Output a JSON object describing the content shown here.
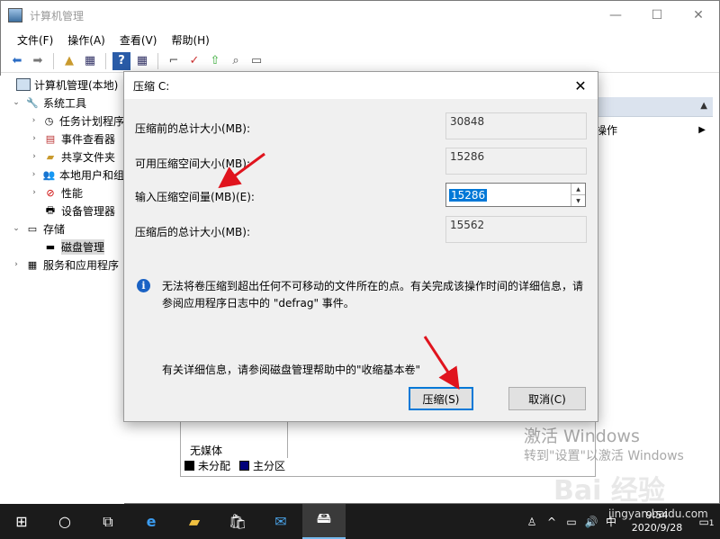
{
  "main": {
    "title": "计算机管理",
    "controls": {
      "minimize": "—",
      "maximize": "☐",
      "close": "✕"
    },
    "menu": [
      "文件(F)",
      "操作(A)",
      "查看(V)",
      "帮助(H)"
    ]
  },
  "tree": {
    "root": "计算机管理(本地)",
    "system_tools": "系统工具",
    "task_scheduler": "任务计划程序",
    "event_viewer": "事件查看器",
    "shared_folders": "共享文件夹",
    "local_users": "本地用户和组",
    "performance": "性能",
    "device_manager": "设备管理器",
    "storage": "存储",
    "disk_management": "磁盘管理",
    "services_apps": "服务和应用程序"
  },
  "actions": {
    "row_label": "操作"
  },
  "lower": {
    "no_media": "无媒体",
    "legend_unallocated": "未分配",
    "legend_primary": "主分区"
  },
  "watermark": {
    "line1": "激活 Windows",
    "line2": "转到\"设置\"以激活 Windows",
    "baidu": "Bai  经验",
    "site": "jingyan.baidu.com"
  },
  "dialog": {
    "title": "压缩 C:",
    "close": "✕",
    "total_before_label": "压缩前的总计大小(MB):",
    "total_before_value": "30848",
    "available_label": "可用压缩空间大小(MB):",
    "available_value": "15286",
    "input_label": "输入压缩空间量(MB)(E):",
    "input_value": "15286",
    "total_after_label": "压缩后的总计大小(MB):",
    "total_after_value": "15562",
    "info_text": "无法将卷压缩到超出任何不可移动的文件所在的点。有关完成该操作时间的详细信息，请参阅应用程序日志中的 \"defrag\" 事件。",
    "help_text": "有关详细信息，请参阅磁盘管理帮助中的\"收缩基本卷\"",
    "shrink_button": "压缩(S)",
    "cancel_button": "取消(C)"
  },
  "taskbar": {
    "time": "9:54",
    "date": "2020/9/28",
    "notifications": "1"
  },
  "colors": {
    "accent": "#0078d7",
    "arrow": "#e0141e",
    "taskbar": "#1b1b1b"
  }
}
